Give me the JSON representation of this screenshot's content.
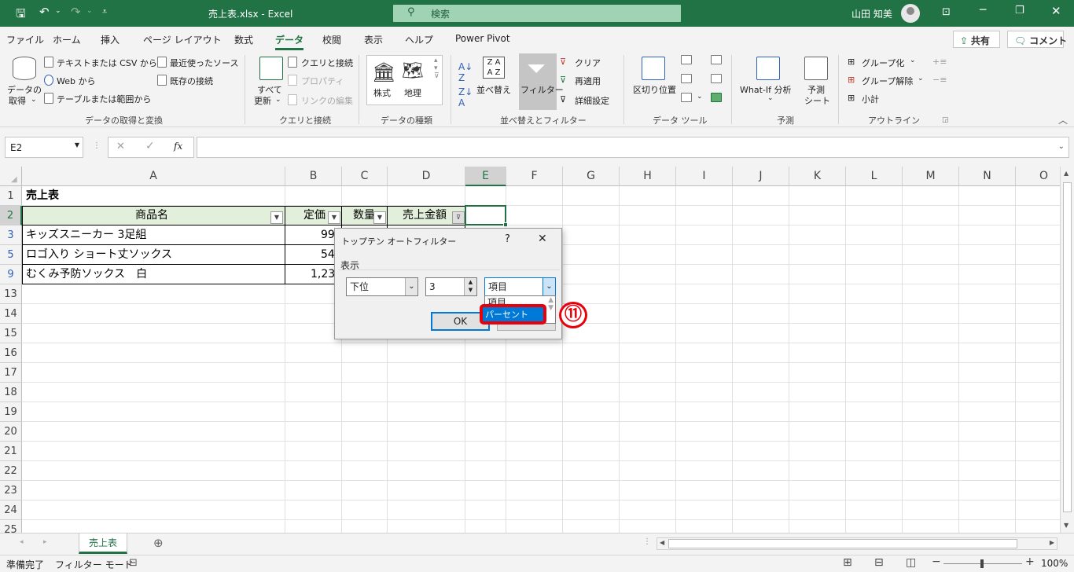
{
  "window": {
    "title": "売上表.xlsx  -  Excel",
    "search_placeholder": "検索",
    "user": "山田 知美"
  },
  "menu": [
    "ファイル",
    "ホーム",
    "挿入",
    "ページ レイアウト",
    "数式",
    "データ",
    "校閲",
    "表示",
    "ヘルプ",
    "Power Pivot"
  ],
  "menu_active": "データ",
  "share_label": "共有",
  "comment_label": "コメント",
  "ribbon": {
    "get_data": "データの",
    "get_data2": "取得",
    "text_csv": "テキストまたは CSV から",
    "web": "Web から",
    "table_range": "テーブルまたは範囲から",
    "recent_sources": "最近使ったソース",
    "existing_conn": "既存の接続",
    "group1": "データの取得と変換",
    "refresh_all": "すべて",
    "refresh_all2": "更新",
    "queries_conn": "クエリと接続",
    "properties": "プロパティ",
    "edit_links": "リンクの編集",
    "group2": "クエリと接続",
    "stocks": "株式",
    "geography": "地理",
    "group3": "データの種類",
    "sort": "並べ替え",
    "filter": "フィルター",
    "clear": "クリア",
    "reapply": "再適用",
    "advanced": "詳細設定",
    "group4": "並べ替えとフィルター",
    "text_to_col": "区切り位置",
    "group5": "データ ツール",
    "whatif": "What-If 分析",
    "forecast": "予測",
    "forecast2": "シート",
    "group6": "予測",
    "group_btn": "グループ化",
    "ungroup_btn": "グループ解除",
    "subtotal": "小計",
    "group7": "アウトライン"
  },
  "formula_bar": {
    "name_box": "E2",
    "fx": "fx",
    "formula": ""
  },
  "columns": [
    "A",
    "B",
    "C",
    "D",
    "E",
    "F",
    "G",
    "H",
    "I",
    "J",
    "K",
    "L",
    "M",
    "N",
    "O"
  ],
  "rows": [
    "1",
    "2",
    "3",
    "5",
    "9",
    "13",
    "14",
    "15",
    "16",
    "17",
    "18",
    "19",
    "20",
    "21",
    "22",
    "23",
    "24",
    "25"
  ],
  "cells": {
    "a1": "売上表",
    "a2": "商品名",
    "b2": "定価",
    "c2": "数量",
    "d2": "売上金額",
    "a3": "キッズスニーカー 3足組",
    "b3": "99",
    "a5": "ロゴ入り ショート丈ソックス",
    "b5": "54",
    "a9": "むくみ予防ソックス　白",
    "b9": "1,23"
  },
  "dialog": {
    "title": "トップテン オートフィルター",
    "help": "?",
    "close": "✕",
    "show_label": "表示",
    "order_value": "下位",
    "count_value": "3",
    "unit_value": "項目",
    "options": [
      "項目",
      "パーセント"
    ],
    "selected_option": "パーセント",
    "ok": "OK",
    "step_badge": "⑪"
  },
  "sheet_tab": "売上表",
  "status": {
    "ready": "準備完了",
    "mode": "フィルター モード",
    "zoom": "100%"
  },
  "colors": {
    "excel_green": "#217346",
    "highlight_red": "#e8000b",
    "select_blue": "#0078d7"
  }
}
